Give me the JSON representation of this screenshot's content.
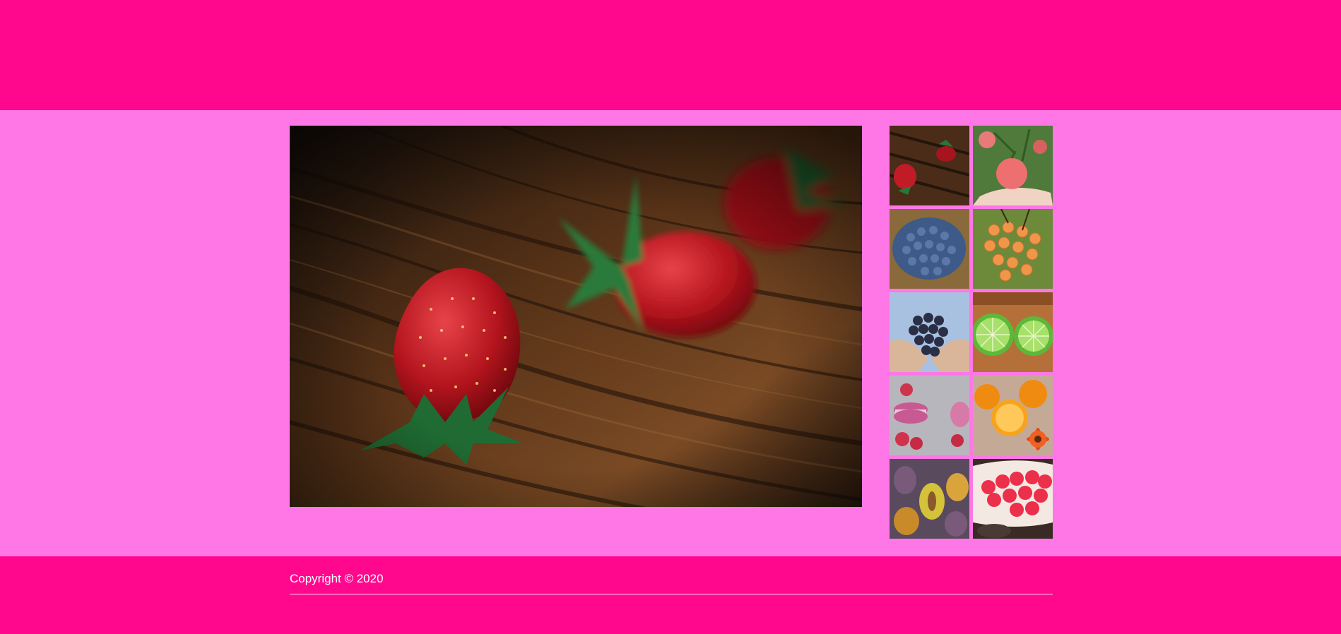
{
  "header": {
    "background": "#ff088e"
  },
  "main": {
    "background": "#ff77e6",
    "featured_image": {
      "icon": "strawberries-on-wood-image"
    }
  },
  "gallery": {
    "thumbnails": [
      {
        "icon": "strawberries-on-wood-thumbnail"
      },
      {
        "icon": "apples-in-hand-thumbnail"
      },
      {
        "icon": "blueberries-thumbnail"
      },
      {
        "icon": "orange-currants-thumbnail"
      },
      {
        "icon": "grapes-in-hands-thumbnail"
      },
      {
        "icon": "limes-thumbnail"
      },
      {
        "icon": "macarons-raspberries-thumbnail"
      },
      {
        "icon": "oranges-flower-thumbnail"
      },
      {
        "icon": "plums-thumbnail"
      },
      {
        "icon": "raspberries-bowl-thumbnail"
      }
    ]
  },
  "footer": {
    "copyright": "Copyright © 2020",
    "background": "#ff088e"
  }
}
